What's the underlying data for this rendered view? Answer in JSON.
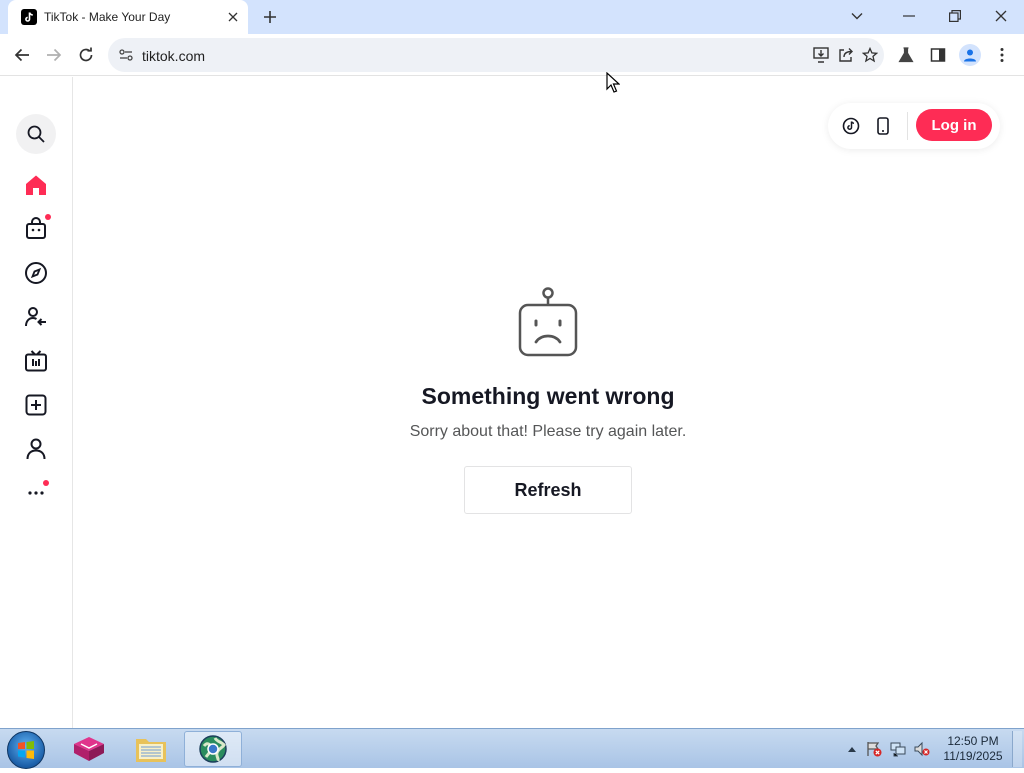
{
  "browser": {
    "tab_title": "TikTok - Make Your Day",
    "url": "tiktok.com"
  },
  "header": {
    "login_label": "Log in"
  },
  "error": {
    "title": "Something went wrong",
    "subtitle": "Sorry about that! Please try again later.",
    "refresh_label": "Refresh"
  },
  "sidebar": {
    "items": [
      {
        "name": "home",
        "icon": "home-icon",
        "active": true
      },
      {
        "name": "shop",
        "icon": "shopping-bag-icon",
        "badge": true
      },
      {
        "name": "explore",
        "icon": "compass-icon"
      },
      {
        "name": "following",
        "icon": "following-icon"
      },
      {
        "name": "live",
        "icon": "live-tv-icon"
      },
      {
        "name": "upload",
        "icon": "plus-square-icon"
      },
      {
        "name": "profile",
        "icon": "person-icon"
      },
      {
        "name": "more",
        "icon": "more-dots-icon",
        "badge": true
      }
    ]
  },
  "taskbar": {
    "time": "12:50 PM",
    "date": "11/19/2025"
  },
  "colors": {
    "accent": "#fe2c55",
    "tabstrip": "#d3e3fd"
  }
}
